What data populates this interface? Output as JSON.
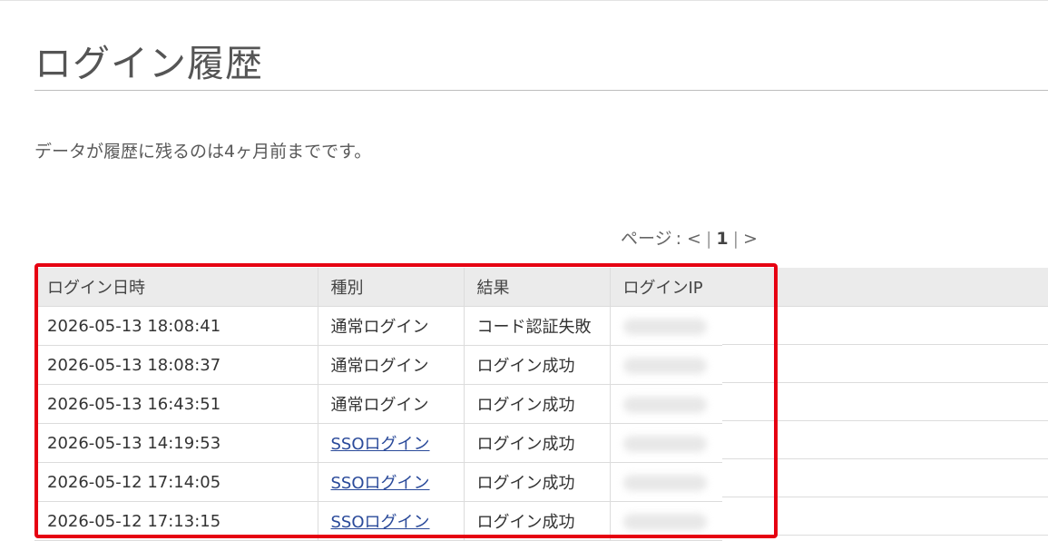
{
  "page": {
    "title": "ログイン履歴",
    "notice": "データが履歴に残るのは4ヶ月前までです。"
  },
  "pager": {
    "label": "ページ",
    "colon": ":",
    "prev": "<",
    "sep": "|",
    "current": "1",
    "next": ">"
  },
  "table": {
    "headers": {
      "datetime": "ログイン日時",
      "type": "種別",
      "result": "結果",
      "ip": "ログインIP"
    },
    "rows": [
      {
        "datetime": "2026-05-13 18:08:41",
        "type": "通常ログイン",
        "type_is_link": false,
        "result": "コード認証失敗",
        "result_status": "fail"
      },
      {
        "datetime": "2026-05-13 18:08:37",
        "type": "通常ログイン",
        "type_is_link": false,
        "result": "ログイン成功",
        "result_status": "success"
      },
      {
        "datetime": "2026-05-13 16:43:51",
        "type": "通常ログイン",
        "type_is_link": false,
        "result": "ログイン成功",
        "result_status": "success"
      },
      {
        "datetime": "2026-05-13 14:19:53",
        "type": "SSOログイン",
        "type_is_link": true,
        "result": "ログイン成功",
        "result_status": "success"
      },
      {
        "datetime": "2026-05-12 17:14:05",
        "type": "SSOログイン",
        "type_is_link": true,
        "result": "ログイン成功",
        "result_status": "success"
      },
      {
        "datetime": "2026-05-12 17:13:15",
        "type": "SSOログイン",
        "type_is_link": true,
        "result": "ログイン成功",
        "result_status": "success"
      }
    ]
  },
  "colors": {
    "fail_text": "#d0101a",
    "link_text": "#2a4a9a",
    "highlight_border": "#e60012",
    "header_bg": "#ebebeb"
  }
}
